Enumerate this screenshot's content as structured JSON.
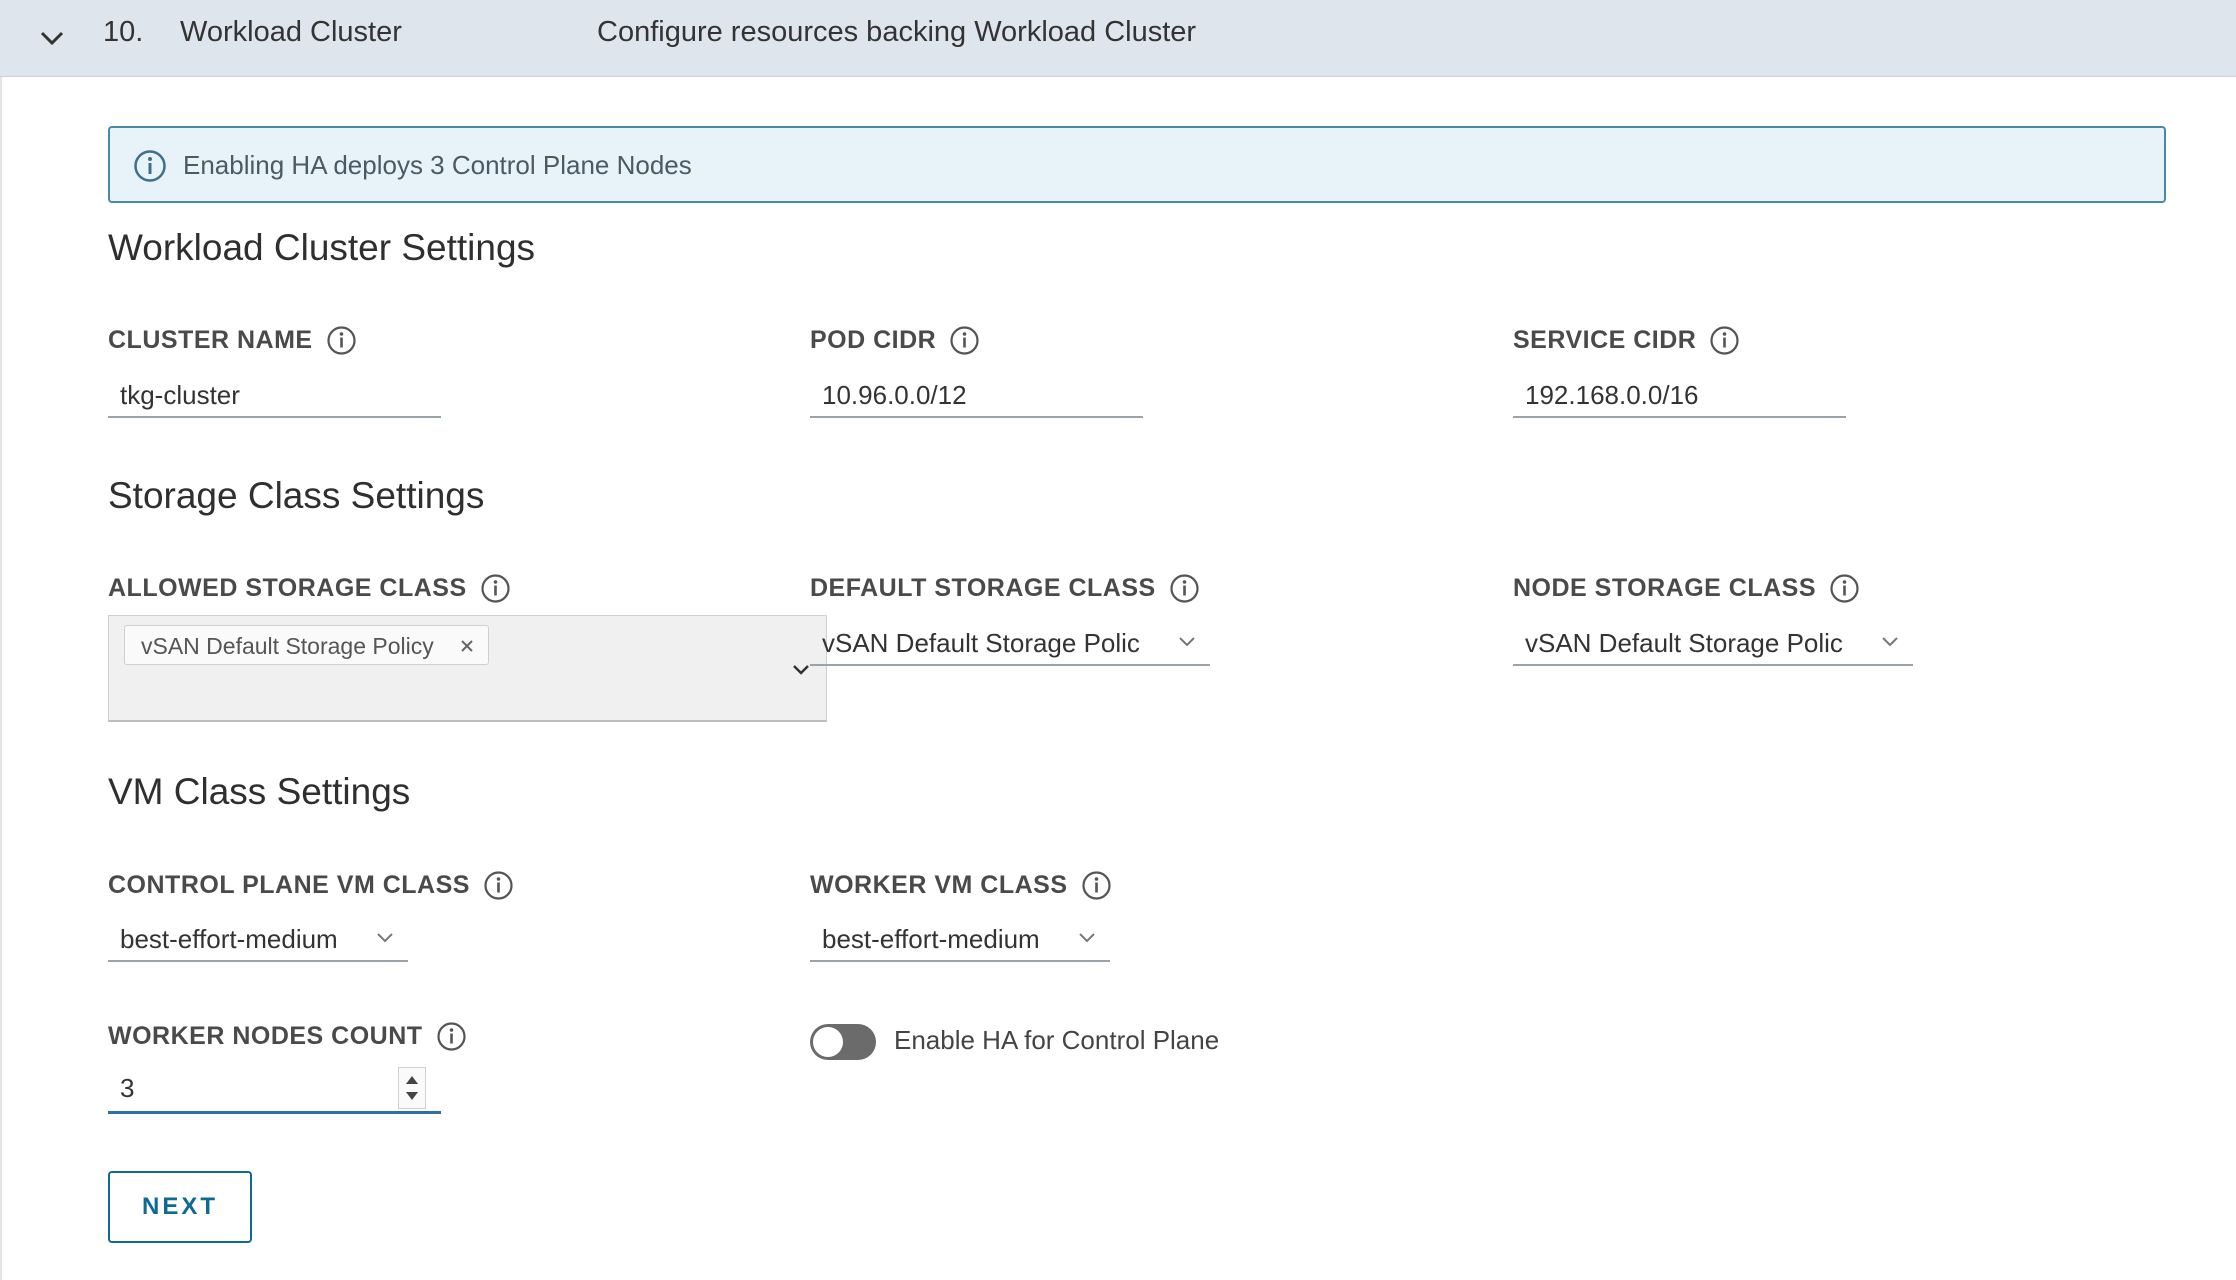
{
  "header": {
    "step": "10.",
    "title": "Workload Cluster",
    "description": "Configure resources backing Workload Cluster"
  },
  "alert": {
    "message": "Enabling HA deploys 3 Control Plane Nodes"
  },
  "cluster_settings": {
    "title": "Workload Cluster Settings",
    "cluster_name": {
      "label": "CLUSTER NAME",
      "value": "tkg-cluster"
    },
    "pod_cidr": {
      "label": "POD CIDR",
      "value": "10.96.0.0/12"
    },
    "service_cidr": {
      "label": "SERVICE CIDR",
      "value": "192.168.0.0/16"
    }
  },
  "storage_settings": {
    "title": "Storage Class Settings",
    "allowed": {
      "label": "ALLOWED STORAGE CLASS",
      "chips": [
        "vSAN Default Storage Policy"
      ]
    },
    "default": {
      "label": "DEFAULT STORAGE CLASS",
      "value": "vSAN Default Storage Polic"
    },
    "node": {
      "label": "NODE STORAGE CLASS",
      "value": "vSAN Default Storage Polic"
    }
  },
  "vm_settings": {
    "title": "VM Class Settings",
    "control_plane": {
      "label": "CONTROL PLANE VM CLASS",
      "value": "best-effort-medium"
    },
    "worker": {
      "label": "WORKER VM CLASS",
      "value": "best-effort-medium"
    },
    "worker_nodes": {
      "label": "WORKER NODES COUNT",
      "value": "3"
    },
    "ha_toggle": {
      "label": "Enable HA for Control Plane",
      "enabled": false
    }
  },
  "actions": {
    "next_label": "NEXT"
  },
  "colors": {
    "accent": "#0e6a94",
    "header_bg": "#dfe5ec",
    "alert_bg": "#e7f3f9",
    "alert_border": "#4a88a8"
  }
}
